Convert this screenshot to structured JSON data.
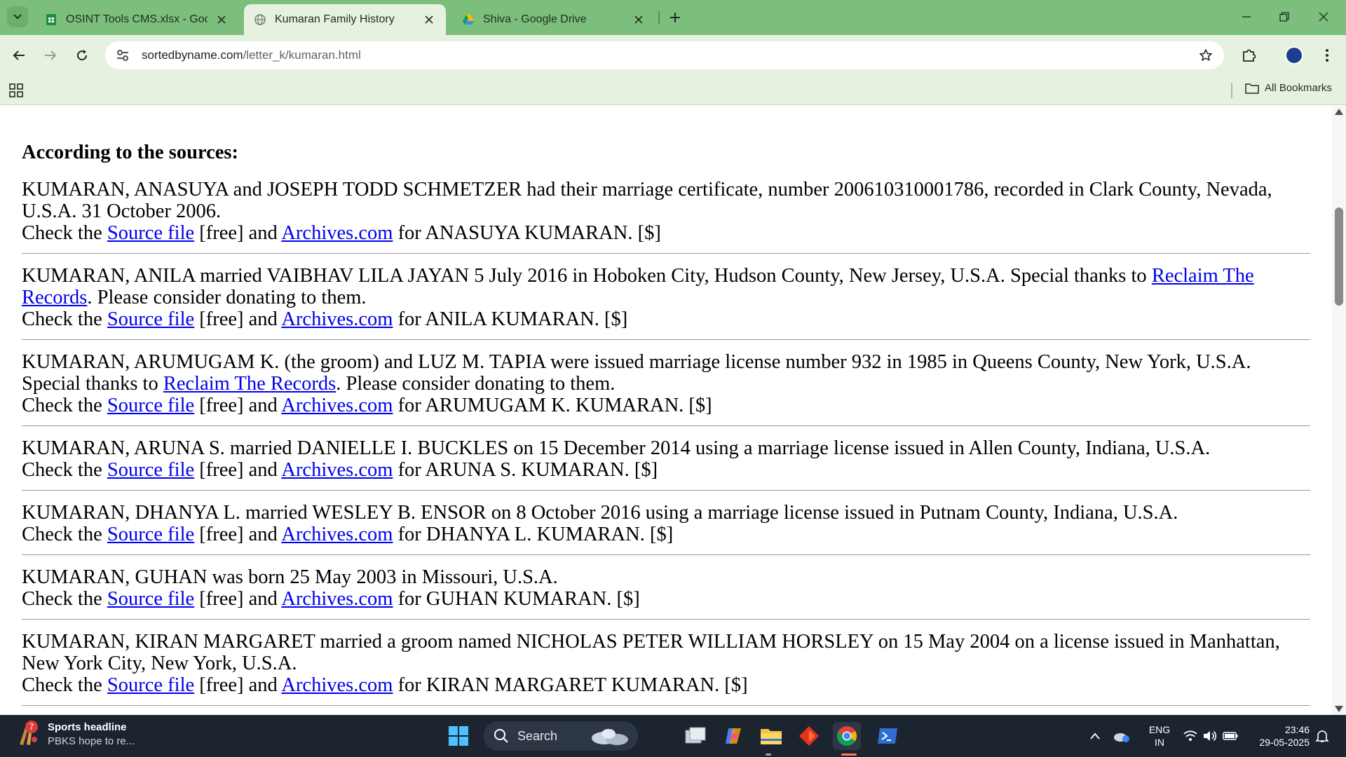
{
  "browser": {
    "tabs": [
      {
        "title": "OSINT Tools CMS.xlsx - Google",
        "icon": "sheets-icon",
        "active": false
      },
      {
        "title": "Kumaran Family History",
        "icon": "globe-icon",
        "active": true
      },
      {
        "title": "Shiva - Google Drive",
        "icon": "drive-icon",
        "active": false
      }
    ],
    "url_host": "sortedbyname.com",
    "url_path": "/letter_k/kumaran.html",
    "bookmarks_label": "All Bookmarks",
    "colors": {
      "frame": "#7cbf7c",
      "toolbar": "#e6f2df",
      "link": "#0000ee"
    }
  },
  "page": {
    "heading": "According to the sources:",
    "check_prefix": "Check the ",
    "source_link": "Source file",
    "free_mid": " [free] and ",
    "archives_link": "Archives.com",
    "donate_suffix": ". Please consider donating to them.",
    "entries": [
      {
        "text": "KUMARAN, ANASUYA and JOSEPH TODD SCHMETZER had their marriage certificate, number 200610310001786, recorded in Clark County, Nevada, U.S.A. 31 October 2006.",
        "check_suffix": " for ANASUYA KUMARAN. [$]"
      },
      {
        "text": "KUMARAN, ANILA married VAIBHAV LILA JAYAN 5 July 2016 in Hoboken City, Hudson County, New Jersey, U.S.A. Special thanks to ",
        "thanks_link": "Reclaim The Records",
        "check_suffix": " for ANILA KUMARAN. [$]"
      },
      {
        "text": "KUMARAN, ARUMUGAM K. (the groom) and LUZ M. TAPIA were issued marriage license number 932 in 1985 in Queens County, New York, U.S.A. Special thanks to ",
        "thanks_link": "Reclaim The Records",
        "check_suffix": " for ARUMUGAM K. KUMARAN. [$]"
      },
      {
        "text": "KUMARAN, ARUNA S. married DANIELLE I. BUCKLES on 15 December 2014 using a marriage license issued in Allen County, Indiana, U.S.A.",
        "check_suffix": " for ARUNA S. KUMARAN. [$]"
      },
      {
        "text": "KUMARAN, DHANYA L. married WESLEY B. ENSOR on 8 October 2016 using a marriage license issued in Putnam County, Indiana, U.S.A.",
        "check_suffix": " for DHANYA L. KUMARAN. [$]"
      },
      {
        "text": "KUMARAN, GUHAN was born 25 May 2003 in Missouri, U.S.A.",
        "check_suffix": " for GUHAN KUMARAN. [$]"
      },
      {
        "text": "KUMARAN, KIRAN MARGARET married a groom named NICHOLAS PETER WILLIAM HORSLEY on 15 May 2004 on a license issued in Manhattan, New York City, New York, U.S.A.",
        "check_suffix": " for KIRAN MARGARET KUMARAN. [$]"
      }
    ]
  },
  "taskbar": {
    "widget_badge": "7",
    "widget_title": "Sports headline",
    "widget_subtitle": "PBKS hope to re...",
    "search_label": "Search",
    "lang_line1": "ENG",
    "lang_line2": "IN",
    "time": "23:46",
    "date": "29-05-2025"
  }
}
